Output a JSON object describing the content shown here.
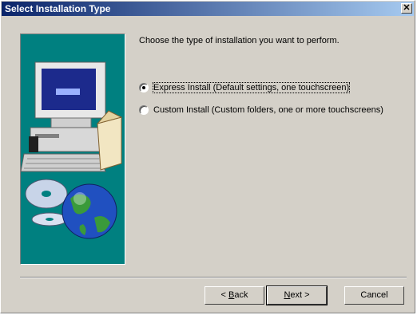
{
  "window": {
    "title": "Select Installation Type",
    "close_glyph": "✕"
  },
  "prompt": "Choose the type of installation you want to perform.",
  "options": [
    {
      "label": "Express Install (Default settings, one touchscreen)",
      "selected": true
    },
    {
      "label": "Custom Install (Custom folders, one or more touchscreens)",
      "selected": false
    }
  ],
  "buttons": {
    "back": {
      "mnemonic": "B",
      "rest": "ack",
      "prefix": "< "
    },
    "next": {
      "mnemonic": "N",
      "rest": "ext >"
    },
    "cancel": "Cancel"
  },
  "colors": {
    "art_bg": "#008080",
    "title_start": "#0a246a",
    "title_end": "#a6caf0"
  },
  "icons": [
    "computer-icon",
    "cd-disc-icon",
    "globe-icon",
    "box-icon"
  ]
}
